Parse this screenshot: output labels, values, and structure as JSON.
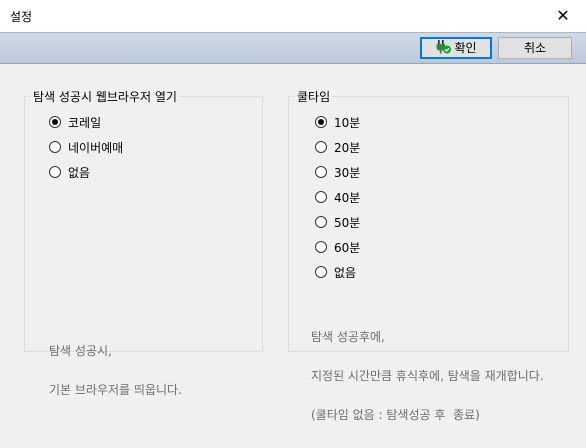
{
  "window": {
    "title": "설정",
    "close_glyph": "✕"
  },
  "toolbar": {
    "ok_label": "확인",
    "cancel_label": "취소"
  },
  "browser_group": {
    "title": "탐색 성공시 웹브라우저 열기",
    "options": [
      {
        "label": "코레일",
        "checked": true
      },
      {
        "label": "네이버예매",
        "checked": false
      },
      {
        "label": "없음",
        "checked": false
      }
    ],
    "note": [
      "탐색 성공시,",
      "기본 브라우저를 띄웁니다."
    ]
  },
  "cooltime_group": {
    "title": "쿨타임",
    "options": [
      {
        "label": "10분",
        "checked": true
      },
      {
        "label": "20분",
        "checked": false
      },
      {
        "label": "30분",
        "checked": false
      },
      {
        "label": "40분",
        "checked": false
      },
      {
        "label": "50분",
        "checked": false
      },
      {
        "label": "60분",
        "checked": false
      },
      {
        "label": "없음",
        "checked": false
      }
    ],
    "note": [
      "탐색 성공후에,",
      "지정된 시간만큼 휴식후에, 탐색을 재개합니다.",
      "(쿨타임 없음 : 탐색성공 후  종료)"
    ]
  }
}
